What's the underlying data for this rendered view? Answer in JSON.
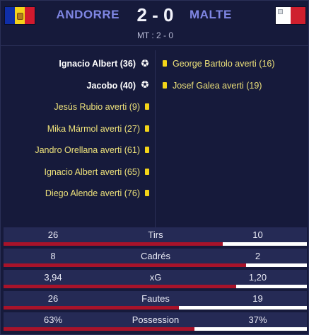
{
  "match": {
    "home_team": "ANDORRE",
    "away_team": "MALTE",
    "score": "2 - 0",
    "half_time": "MT : 2 - 0"
  },
  "events": {
    "home": [
      {
        "text": "Ignacio Albert (36)",
        "type": "goal",
        "icon": "soccer-ball-icon"
      },
      {
        "text": "Jacobo (40)",
        "type": "goal",
        "icon": "soccer-ball-icon"
      },
      {
        "text": "Jesús Rubio averti (9)",
        "type": "card",
        "icon": "yellow-card-icon"
      },
      {
        "text": "Mika Mármol averti (27)",
        "type": "card",
        "icon": "yellow-card-icon"
      },
      {
        "text": "Jandro Orellana averti (61)",
        "type": "card",
        "icon": "yellow-card-icon"
      },
      {
        "text": "Ignacio Albert averti (65)",
        "type": "card",
        "icon": "yellow-card-icon"
      },
      {
        "text": "Diego Alende averti (76)",
        "type": "card",
        "icon": "yellow-card-icon"
      }
    ],
    "away": [
      {
        "text": "George Bartolo averti (16)",
        "type": "card",
        "icon": "yellow-card-icon"
      },
      {
        "text": "Josef Galea averti (19)",
        "type": "card",
        "icon": "yellow-card-icon"
      }
    ]
  },
  "stats": [
    {
      "label": "Tirs",
      "home": "26",
      "away": "10",
      "home_share": 0.722
    },
    {
      "label": "Cadrés",
      "home": "8",
      "away": "2",
      "home_share": 0.8
    },
    {
      "label": "xG",
      "home": "3,94",
      "away": "1,20",
      "home_share": 0.767
    },
    {
      "label": "Fautes",
      "home": "26",
      "away": "19",
      "home_share": 0.578
    },
    {
      "label": "Possession",
      "home": "63%",
      "away": "37%",
      "home_share": 0.63
    }
  ],
  "colors": {
    "background": "#161a3b",
    "team_name": "#7f86e3",
    "bar_home": "#a8132a",
    "bar_away": "#ffffff",
    "card_text": "#ece07a",
    "yellow_card": "#f3d418"
  }
}
